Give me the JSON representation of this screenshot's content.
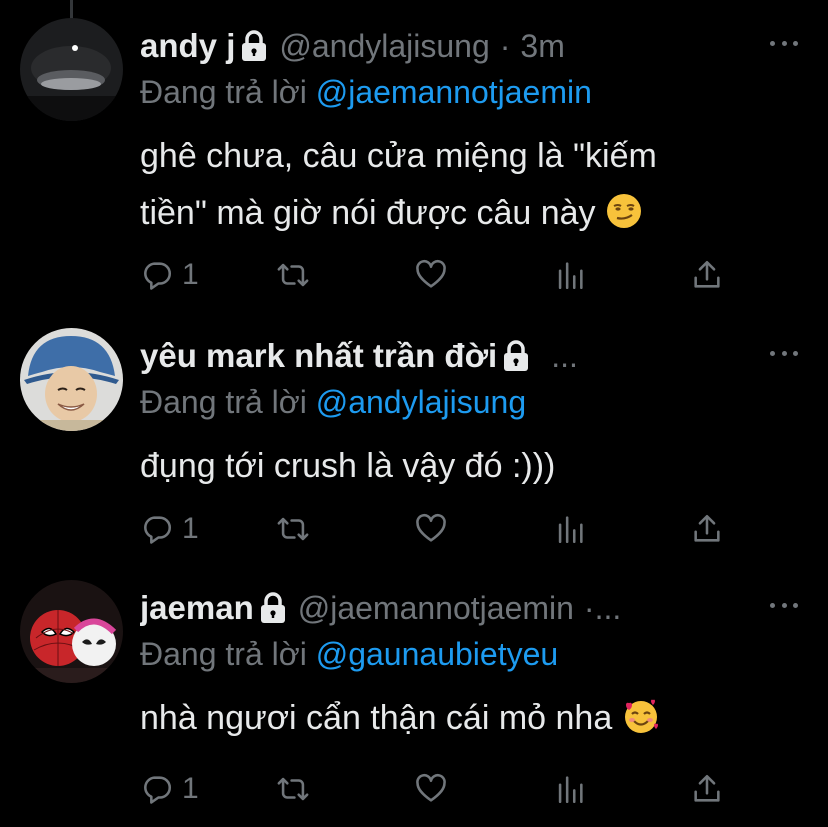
{
  "tweets": [
    {
      "name": "andy j",
      "handle": "@andylajisung",
      "dot": "·",
      "time": "3m",
      "reply_prefix": "Đang trả lời ",
      "reply_to": "@jaemannotjaemin",
      "text_line1": "ghê chưa, câu cửa miệng là \"kiếm",
      "text_line2": "tiền\" mà giờ nói được câu này ",
      "emoji": "smirk-emoji",
      "reply_count": "1"
    },
    {
      "name": "yêu mark nhất trần đời",
      "handle": "",
      "dot": "...",
      "time": "",
      "reply_prefix": "Đang trả lời ",
      "reply_to": "@andylajisung",
      "text_line1": "đụng tới crush là vậy đó :)))",
      "text_line2": "",
      "emoji": "",
      "reply_count": "1"
    },
    {
      "name": "jaeman",
      "handle": "@jaemannotjaemin",
      "dot": "·...",
      "time": "",
      "reply_prefix": "Đang trả lời ",
      "reply_to": "@gaunaubietyeu",
      "text_line1": "nhà ngươi cẩn thận cái mỏ nha ",
      "text_line2": "",
      "emoji": "smiling-face-with-hearts-emoji",
      "reply_count": "1"
    }
  ],
  "colors": {
    "background": "#000000",
    "text": "#e7e9ea",
    "muted": "#71767b",
    "link": "#1d9bf0"
  }
}
